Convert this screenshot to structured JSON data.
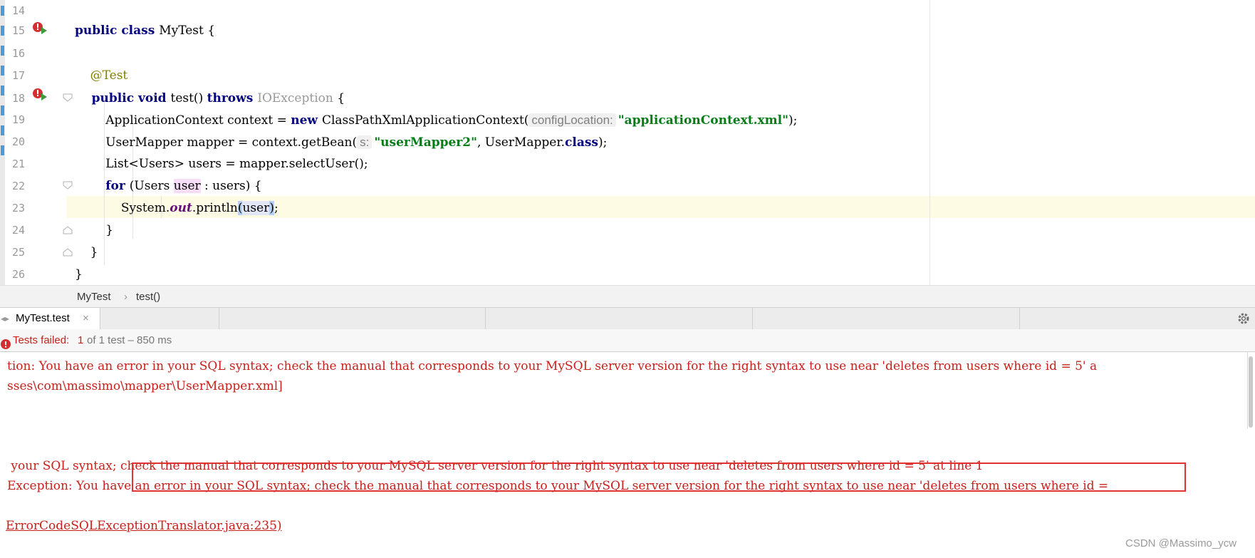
{
  "editor": {
    "lines": [
      {
        "num": "14"
      },
      {
        "num": "15",
        "parts": [
          {
            "t": "public class ",
            "c": "kw"
          },
          {
            "t": "MyTest {",
            "c": ""
          }
        ]
      },
      {
        "num": "16"
      },
      {
        "num": "17",
        "parts": [
          {
            "t": "    @Test",
            "c": "ann"
          }
        ]
      },
      {
        "num": "18",
        "parts": [
          {
            "t": "    public void ",
            "c": "kw"
          },
          {
            "t": "test() ",
            "c": ""
          },
          {
            "t": "throws ",
            "c": "kw"
          },
          {
            "t": "IOException",
            "c": "gray"
          },
          {
            "t": " {",
            "c": ""
          }
        ]
      },
      {
        "num": "19",
        "parts": [
          {
            "t": "        ApplicationContext context = ",
            "c": ""
          },
          {
            "t": "new ",
            "c": "kw"
          },
          {
            "t": "ClassPathXmlApplicationContext(",
            "c": ""
          },
          {
            "t": "configLocation:",
            "c": "hint"
          },
          {
            "t": "\"applicationContext.xml\"",
            "c": "str"
          },
          {
            "t": ");",
            "c": ""
          }
        ]
      },
      {
        "num": "20",
        "parts": [
          {
            "t": "        UserMapper mapper = context.getBean(",
            "c": ""
          },
          {
            "t": "s:",
            "c": "hint"
          },
          {
            "t": "\"userMapper2\"",
            "c": "str"
          },
          {
            "t": ", UserMapper.",
            "c": ""
          },
          {
            "t": "class",
            "c": "kw"
          },
          {
            "t": ");",
            "c": ""
          }
        ]
      },
      {
        "num": "21",
        "parts": [
          {
            "t": "        List<Users> users = mapper.selectUser();",
            "c": ""
          }
        ]
      },
      {
        "num": "22",
        "parts": [
          {
            "t": "        ",
            "c": ""
          },
          {
            "t": "for ",
            "c": "kw"
          },
          {
            "t": "(Users ",
            "c": ""
          },
          {
            "t": "user",
            "c": "hl-var"
          },
          {
            "t": " : users) {",
            "c": ""
          }
        ]
      },
      {
        "num": "23",
        "parts": [
          {
            "t": "            System.",
            "c": ""
          },
          {
            "t": "out",
            "c": "static-f"
          },
          {
            "t": ".println",
            "c": ""
          },
          {
            "t": "(",
            "c": "hl-paren"
          },
          {
            "t": "user",
            "c": "hl-arg"
          },
          {
            "t": ")",
            "c": "hl-paren"
          },
          {
            "t": ";",
            "c": ""
          }
        ]
      },
      {
        "num": "24",
        "parts": [
          {
            "t": "        }",
            "c": ""
          }
        ]
      },
      {
        "num": "25",
        "parts": [
          {
            "t": "    }",
            "c": ""
          }
        ]
      },
      {
        "num": "26",
        "parts": [
          {
            "t": "}",
            "c": ""
          }
        ]
      }
    ]
  },
  "breadcrumb": {
    "class_name": "MyTest",
    "separator": "›",
    "method": "test()"
  },
  "run_panel": {
    "tab_label": "MyTest.test",
    "close_glyph": "×",
    "status_label": "Tests failed:",
    "failed_count": "1",
    "status_detail": "of 1 test – 850 ms"
  },
  "console": {
    "lines": [
      "tion: You have an error in your SQL syntax; check the manual that corresponds to your MySQL server version for the right syntax to use near 'deletes from users where id = 5' a",
      "sses\\com\\massimo\\mapper\\UserMapper.xml]",
      "",
      "",
      "",
      " your SQL syntax; check the manual that corresponds to your MySQL server version for the right syntax to use near 'deletes from users where id = 5' at line 1",
      "Exception: You have an error in your SQL syntax; check the manual that corresponds to your MySQL server version for the right syntax to use near 'deletes from users where id =",
      "",
      "ErrorCodeSQLExceptionTranslator.java:235)"
    ]
  },
  "watermark": "CSDN @Massimo_ycw",
  "colors": {
    "keyword": "#000080",
    "string": "#067d17",
    "annotation": "#808000",
    "error_text": "#c8201b",
    "highlight_box": "#e23333",
    "current_line": "#fdfbe3"
  },
  "icons": {
    "run_test": "run-test-icon",
    "fold": "fold-icon",
    "settings": "gear-icon",
    "failed": "error-icon"
  }
}
